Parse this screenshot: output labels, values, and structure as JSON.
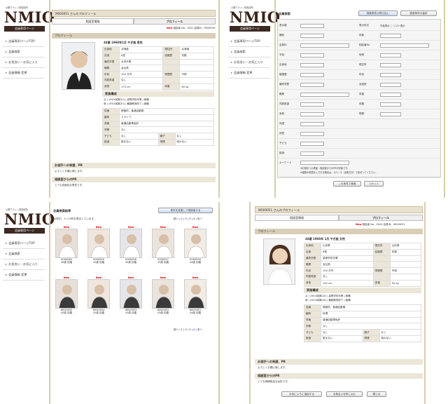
{
  "brand": {
    "sub": "公開ウラィン型相談所",
    "logo": "NMIO",
    "member": "会員専用ページ"
  },
  "menu": [
    "会員専用ページTOP",
    "会員検索",
    "お見合い・お気に入り",
    "会員情報 変更"
  ],
  "tabs": [
    "相談室情報",
    "プロフィール"
  ],
  "p1": {
    "title": "M000051 さんのプロフィール",
    "newline": "相談者 No：0001 会員ID：M000051",
    "section": "プロフィール",
    "headline": "44歳 1969年1月 やぎ座 男性",
    "rows": [
      [
        "出身地",
        "北海道",
        "現住所",
        "北海道"
      ],
      [
        "血液",
        "A型",
        "結婚歴",
        "初婚"
      ],
      [
        "最終学歴",
        "大学卒業",
        "",
        " "
      ],
      [
        "職業",
        "会社員",
        "",
        ""
      ],
      [
        "年収",
        "100 万円",
        "喫煙歴",
        "不明"
      ],
      [
        "同居希望",
        "なし",
        "",
        ""
      ],
      [
        "身長",
        "170 cm",
        "体重",
        "60 kg"
      ]
    ],
    "family_h": "家族構成",
    "family": "父 | 1945(昭和20) | 高等学校卒業 | 無職",
    "family2": "母 | 1945(昭和20) | 義務教育終了 | 無職",
    "rows2": [
      [
        "性格",
        "積極的、普通自動車"
      ],
      [
        "趣味",
        "ドライブ"
      ],
      [
        "資格",
        "普通自動車免許"
      ],
      [
        "宗教",
        "なし"
      ],
      [
        "子ども",
        "なし",
        "親子",
        "なし"
      ],
      [
        "飲酒",
        "飲まない",
        "喫煙",
        "吸わない"
      ]
    ],
    "pr_h": "お相手への希望、PR",
    "pr": "よろしくお願い致します。",
    "cpr_h": "相談室からのPR",
    "cpr": "とても真面目な男性です。"
  },
  "p2": {
    "title": "会員検索",
    "btn1": "検索条件の呼び出し",
    "btn2": "検索条件の保存",
    "labels": [
      "表示順",
      "種別",
      "会員ID",
      "写真",
      "出身地",
      "婚姻歴",
      "最終学歴",
      "職業",
      "同居希望",
      "身長",
      "体重",
      "体型",
      "子ども",
      "飲酒",
      "キーワード"
    ],
    "right": [
      "表示形式",
      "年齢",
      "相談者No",
      "地域",
      "現住所",
      "年収",
      "血液型",
      "体重",
      "体格",
      "喫煙"
    ],
    "disp": "写真表示 ○ リスト表示",
    "kw": "※お相手への希望・相談室からのPRが対象です。",
    "kw2": "※複数の単語を入力する場合は、スペース（全角文字）で区切ってください。",
    "search": "この条件で検索",
    "reset": "リセット"
  },
  "p3": {
    "title": "会員検索結果",
    "btn": "条件を変更して再検索する",
    "count": "40件中、1〜10件を表示しています。",
    "pager": "前へ | 1 | 2 | 3 | 4 | 次へ",
    "items": [
      [
        "K000060",
        "40歳 初婚"
      ],
      [
        "K000059",
        "41歳 初婚"
      ],
      [
        "K000058",
        "42歳 初婚"
      ],
      [
        "K000057",
        "43歳 初婚"
      ],
      [
        "K000056",
        "44歳 初婚"
      ],
      [
        "W000055",
        "40歳 初婚"
      ],
      [
        "W000054",
        "41歳 初婚"
      ],
      [
        "W000053",
        "42歳 初婚"
      ],
      [
        "W000052",
        "43歳 初婚"
      ],
      [
        "W000051",
        "44歳 初婚"
      ]
    ],
    "new": "New"
  },
  "p4": {
    "title": "W000051 さんのプロフィール",
    "newline": "相談者 No：0004 会員ID：W000051",
    "section": "プロフィール",
    "headline": "44歳 1969年 1月 やぎ座 女性",
    "rows": [
      [
        "出身地",
        "山形県",
        "現住所",
        "山形県"
      ],
      [
        "血液",
        "B型",
        "結婚歴",
        "初婚"
      ],
      [
        "最終学歴",
        "高等学校卒業",
        "",
        ""
      ],
      [
        "職業",
        "会社員",
        "",
        ""
      ],
      [
        "年収",
        "100 万円",
        "喫煙歴",
        "不明"
      ],
      [
        "同居希望",
        "なし",
        "",
        ""
      ],
      [
        "身長",
        "150 cm",
        "体重",
        "50 kg"
      ]
    ],
    "family_h": "家族構成",
    "family": "父 | 1943(昭和18) | 高等学校卒業 | 無職",
    "family2": "母 | 1943(昭和18) | 義務教育終了 | 無職",
    "rows2": [
      [
        "性格",
        "積極的、普通自動車"
      ],
      [
        "趣味",
        "料理"
      ],
      [
        "資格",
        "普通自動車免許"
      ],
      [
        "宗教",
        "なし"
      ],
      [
        "子ども",
        "なし",
        "親子",
        "なし"
      ],
      [
        "飲酒",
        "飲まない",
        "喫煙",
        "吸わない"
      ]
    ],
    "pr_h": "お相手への希望、PR",
    "pr": "よろしくお願い致します。",
    "cpr_h": "相談室からのPR",
    "cpr": "とても明朗快活な女性です。",
    "b1": "お気に入りに追加する",
    "b2": "お見合いを申し込む",
    "b3": "閉じる"
  }
}
